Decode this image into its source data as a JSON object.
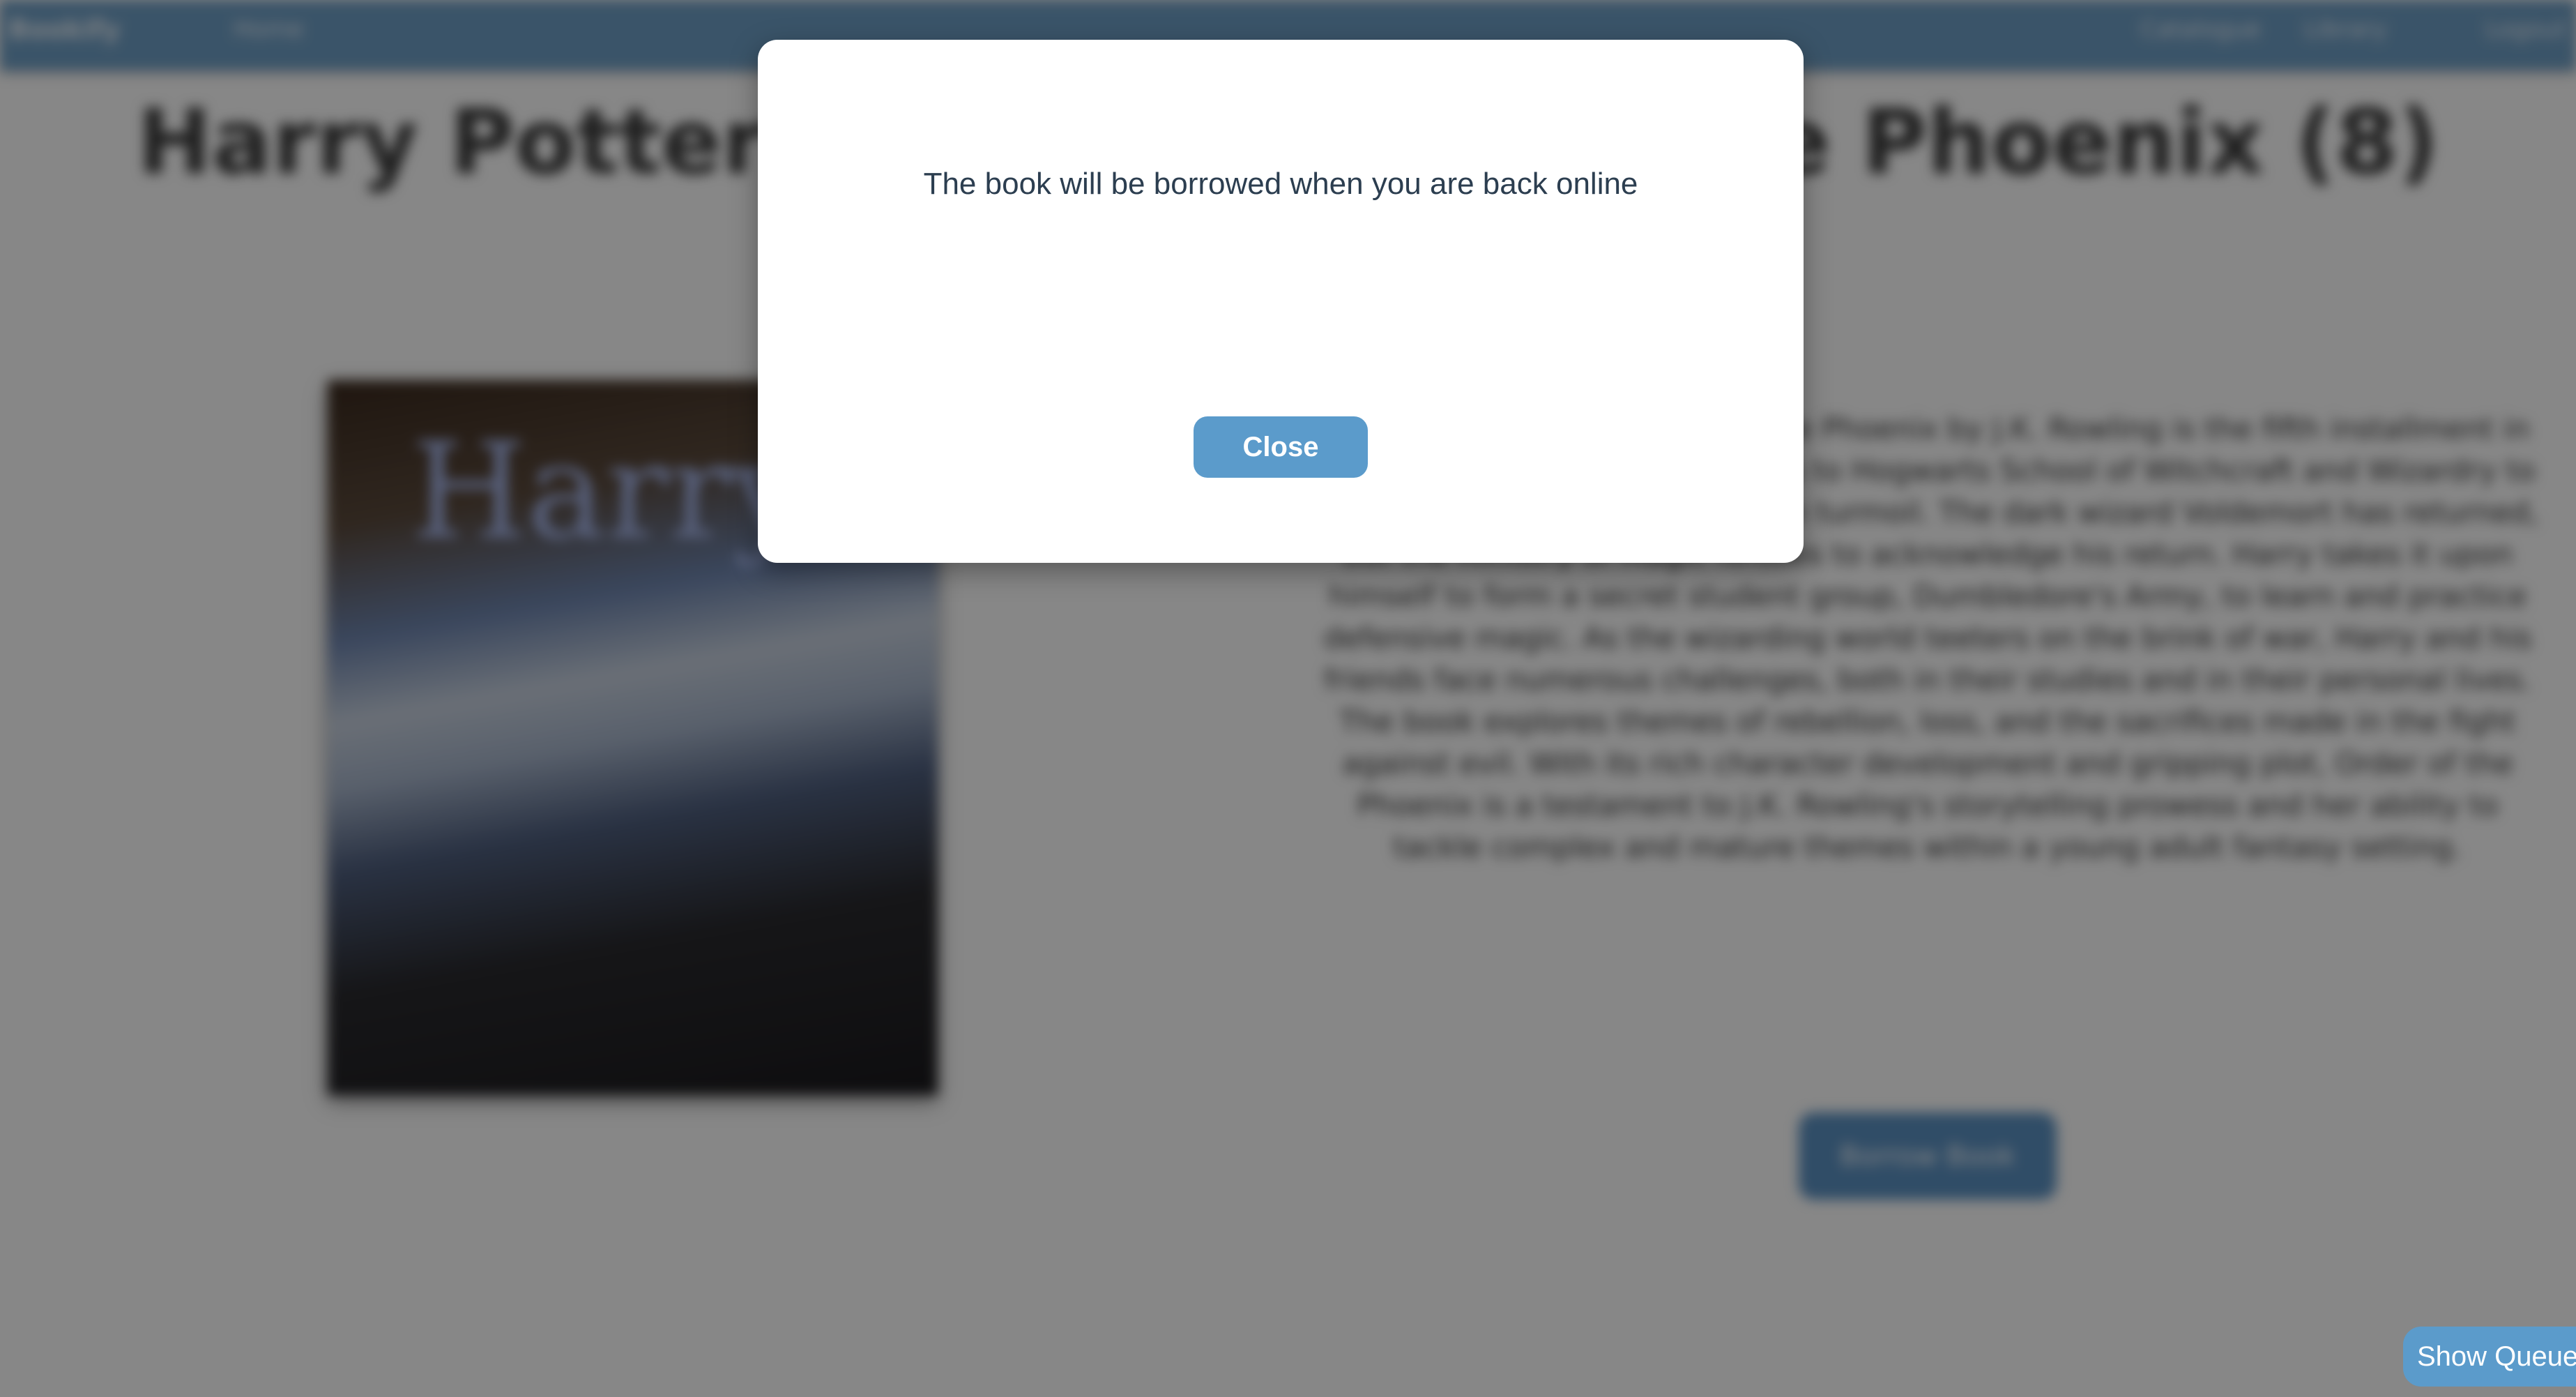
{
  "navbar": {
    "brand": "Bookify",
    "home": "Home",
    "catalogue": "Catalogue",
    "library": "Library",
    "logout": "Logout"
  },
  "book": {
    "title": "Harry Potter and the Order of the Phoenix (8)",
    "cover_text": "Harry Potter",
    "description": "Harry Potter and the Order of the Phoenix by J.K. Rowling is the fifth installment in the beloved series. Harry returns to Hogwarts School of Witchcraft and Wizardry to find that the wizarding world is in turmoil. The dark wizard Voldemort has returned, but the Ministry of Magic refuses to acknowledge his return. Harry takes it upon himself to form a secret student group, Dumbledore's Army, to learn and practice defensive magic. As the wizarding world teeters on the brink of war, Harry and his friends face numerous challenges, both in their studies and in their personal lives. The book explores themes of rebellion, loss, and the sacrifices made in the fight against evil. With its rich character development and gripping plot, Order of the Phoenix is a testament to J.K. Rowling's storytelling prowess and her ability to tackle complex and mature themes within a young adult fantasy setting.",
    "borrow_label": "Borrow Book"
  },
  "modal": {
    "message": "The book will be borrowed when you are back online",
    "close_label": "Close"
  },
  "queue": {
    "show_label": "Show Queue"
  },
  "colors": {
    "navbar": "#6f9fc6",
    "accent_button": "#5b9bcb",
    "modal_text": "#2c3e50",
    "overlay": "rgba(0,0,0,0.47)"
  }
}
